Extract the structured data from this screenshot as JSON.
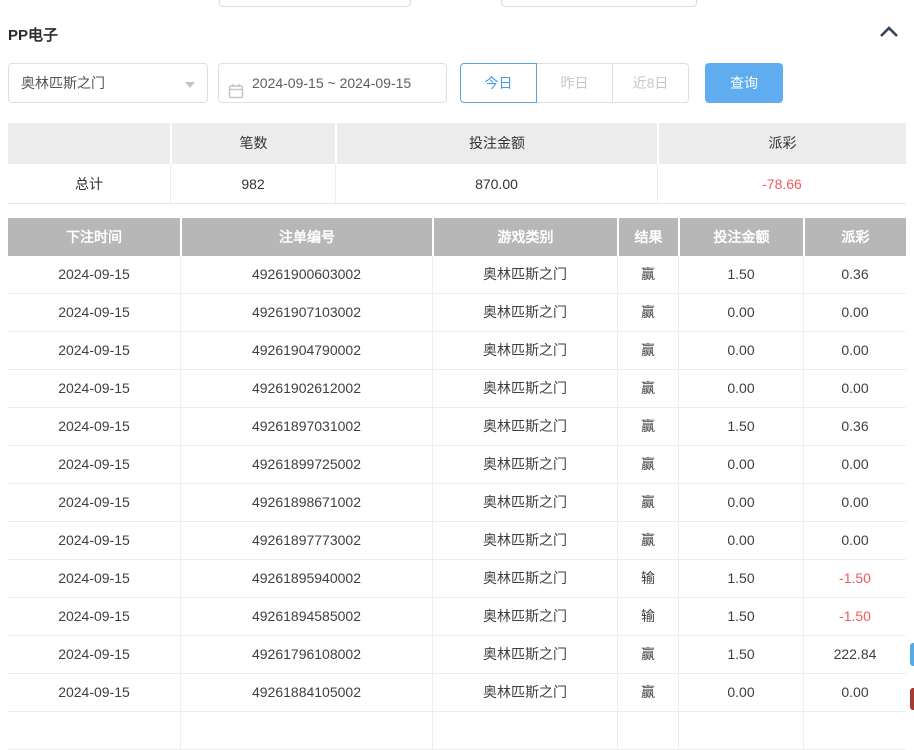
{
  "panel": {
    "title": "PP电子"
  },
  "filters": {
    "game_select_value": "奥林匹斯之门",
    "date_range_value": "2024-09-15 ~ 2024-09-15",
    "today_label": "今日",
    "yesterday_label": "昨日",
    "last8_label": "近8日",
    "query_label": "查询"
  },
  "summary": {
    "headers": [
      "",
      "笔数",
      "投注金额",
      "派彩"
    ],
    "total_label": "总计",
    "count": "982",
    "bet_amount": "870.00",
    "payout": "-78.66"
  },
  "table": {
    "headers": [
      "下注时间",
      "注单编号",
      "游戏类别",
      "结果",
      "投注金额",
      "派彩"
    ],
    "rows": [
      [
        "2024-09-15",
        "49261900603002",
        "奥林匹斯之门",
        "赢",
        "1.50",
        "0.36"
      ],
      [
        "2024-09-15",
        "49261907103002",
        "奥林匹斯之门",
        "赢",
        "0.00",
        "0.00"
      ],
      [
        "2024-09-15",
        "49261904790002",
        "奥林匹斯之门",
        "赢",
        "0.00",
        "0.00"
      ],
      [
        "2024-09-15",
        "49261902612002",
        "奥林匹斯之门",
        "赢",
        "0.00",
        "0.00"
      ],
      [
        "2024-09-15",
        "49261897031002",
        "奥林匹斯之门",
        "赢",
        "1.50",
        "0.36"
      ],
      [
        "2024-09-15",
        "49261899725002",
        "奥林匹斯之门",
        "赢",
        "0.00",
        "0.00"
      ],
      [
        "2024-09-15",
        "49261898671002",
        "奥林匹斯之门",
        "赢",
        "0.00",
        "0.00"
      ],
      [
        "2024-09-15",
        "49261897773002",
        "奥林匹斯之门",
        "赢",
        "0.00",
        "0.00"
      ],
      [
        "2024-09-15",
        "49261895940002",
        "奥林匹斯之门",
        "输",
        "1.50",
        "-1.50"
      ],
      [
        "2024-09-15",
        "49261894585002",
        "奥林匹斯之门",
        "输",
        "1.50",
        "-1.50"
      ],
      [
        "2024-09-15",
        "49261796108002",
        "奥林匹斯之门",
        "赢",
        "1.50",
        "222.84"
      ],
      [
        "2024-09-15",
        "49261884105002",
        "奥林匹斯之门",
        "赢",
        "0.00",
        "0.00"
      ]
    ]
  },
  "colors": {
    "query_button_blue": "#5fadf0",
    "active_tab_blue": "#4a9de5",
    "negative_red": "#f15b5b",
    "table_header_gray": "#b7b7b7",
    "summary_header_gray": "#ececec",
    "edge_widget_blue": "#55aae8",
    "edge_widget_red": "#a43a32"
  }
}
